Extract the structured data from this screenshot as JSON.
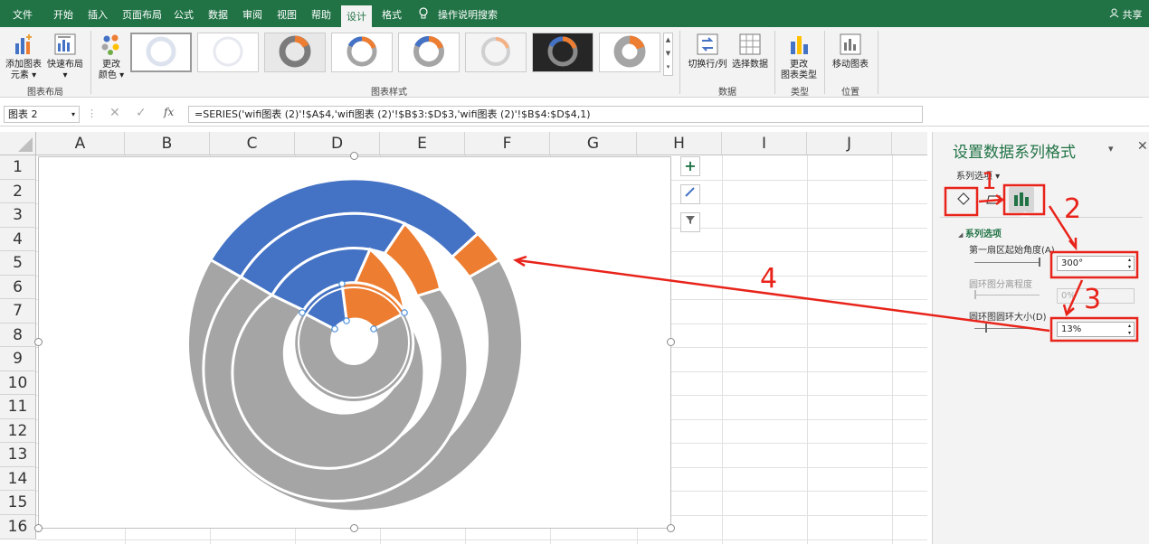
{
  "tabs": [
    "文件",
    "开始",
    "插入",
    "页面布局",
    "公式",
    "数据",
    "审阅",
    "视图",
    "帮助",
    "设计",
    "格式"
  ],
  "active_tab": "设计",
  "tell_me": "操作说明搜索",
  "share": "共享",
  "ribbon": {
    "add_element_l1": "添加图表",
    "add_element_l2": "元素",
    "quick_layout": "快速布局",
    "change_color_l1": "更改",
    "change_color_l2": "颜色",
    "group_layout": "图表布局",
    "group_styles": "图表样式",
    "switch_rowcol": "切换行/列",
    "select_data": "选择数据",
    "group_data": "数据",
    "change_type_l1": "更改",
    "change_type_l2": "图表类型",
    "group_type": "类型",
    "move_chart": "移动图表",
    "group_location": "位置"
  },
  "formula_bar": {
    "name_box": "图表 2",
    "fx": "fx",
    "formula": "=SERIES('wifi图表 (2)'!$A$4,'wifi图表 (2)'!$B$3:$D$3,'wifi图表 (2)'!$B$4:$D$4,1)"
  },
  "columns": [
    "A",
    "B",
    "C",
    "D",
    "E",
    "F",
    "G",
    "H",
    "I",
    "J"
  ],
  "rows": [
    "1",
    "2",
    "3",
    "4",
    "5",
    "6",
    "7",
    "8",
    "9",
    "10",
    "11",
    "12",
    "13",
    "14",
    "15",
    "16"
  ],
  "pane": {
    "title": "设置数据系列格式",
    "series_options_dropdown": "系列选项",
    "section": "系列选项",
    "first_slice_angle_label": "第一扇区起始角度(A)",
    "first_slice_angle_value": "300°",
    "explosion_label": "圆环图分离程度",
    "explosion_value": "0%",
    "hole_size_label": "圆环图圆环大小(D)",
    "hole_size_value": "13%"
  },
  "annotations": {
    "n1": "1",
    "n2": "2",
    "n3": "3",
    "n4": "4"
  },
  "colors": {
    "blue": "#4472c4",
    "orange": "#ed7d31",
    "gray": "#a5a5a5",
    "accent": "#217346",
    "red": "#e8231a"
  }
}
